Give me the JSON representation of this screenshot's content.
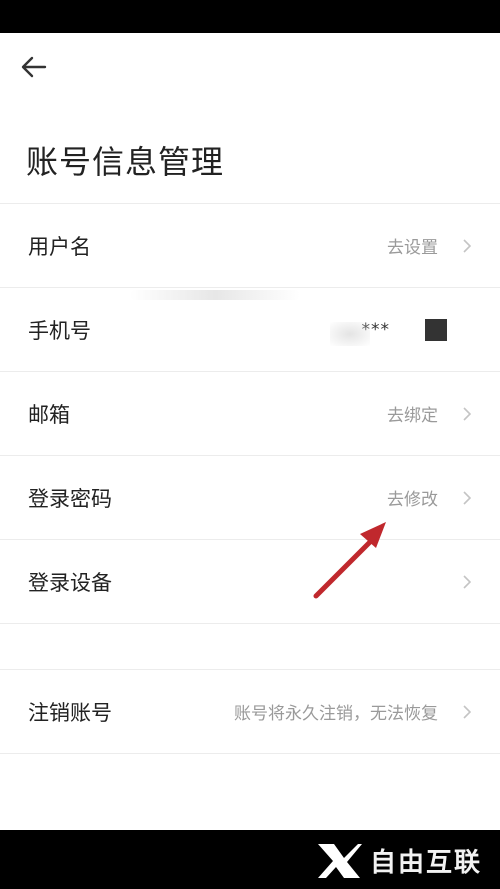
{
  "header": {
    "title": "账号信息管理"
  },
  "rows": [
    {
      "label": "用户名",
      "value": "去设置"
    },
    {
      "label": "手机号",
      "value": "***"
    },
    {
      "label": "邮箱",
      "value": "去绑定"
    },
    {
      "label": "登录密码",
      "value": "去修改"
    },
    {
      "label": "登录设备",
      "value": ""
    }
  ],
  "cancel": {
    "label": "注销账号",
    "value": "账号将永久注销，无法恢复"
  },
  "watermark": {
    "text": "自由互联"
  },
  "colors": {
    "annotation_arrow": "#c0282d",
    "secondary_text": "#9a9a9a",
    "divider": "#ececec"
  },
  "icons": {
    "back": "arrow-left-icon",
    "chevron": "chevron-right-icon",
    "logo": "x-logo-icon"
  }
}
